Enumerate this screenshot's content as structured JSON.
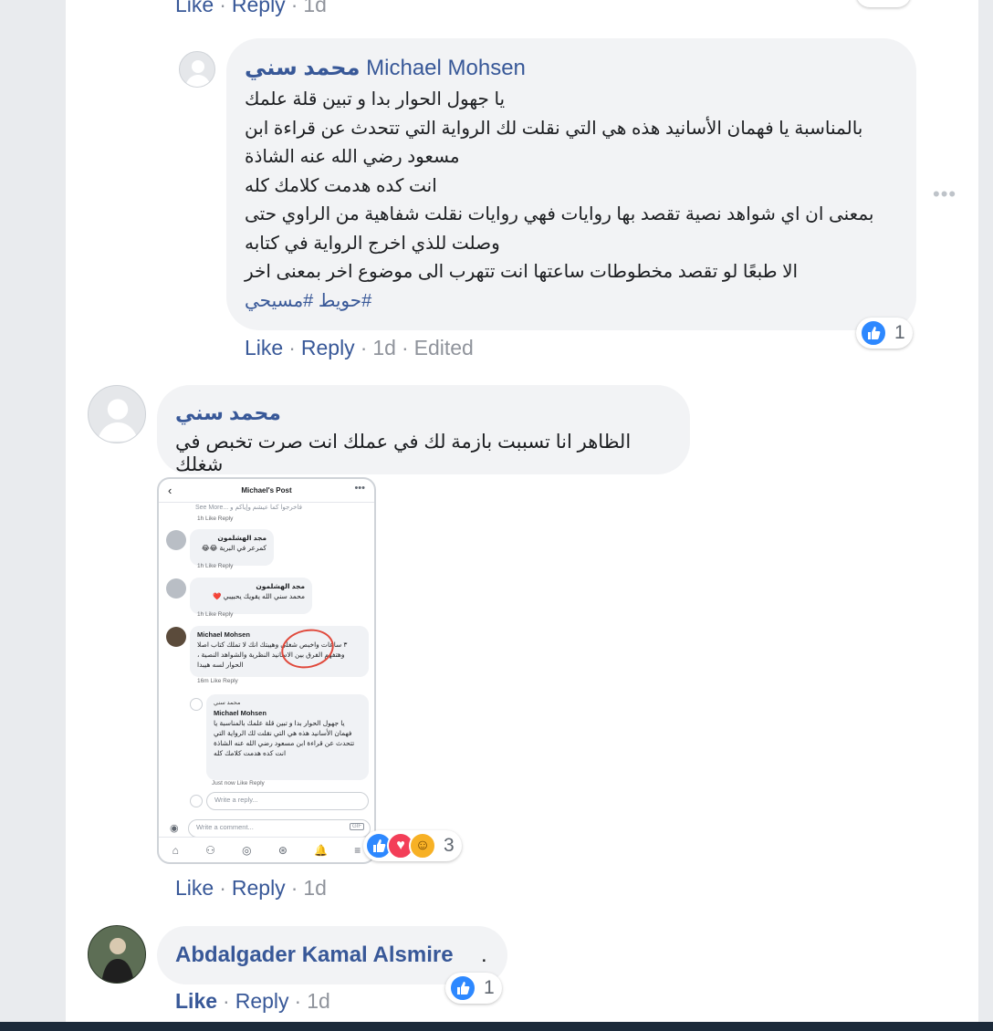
{
  "top_meta": {
    "like": "Like",
    "reply": "Reply",
    "time": "1d"
  },
  "reply_comment": {
    "author_arabic": "محمد سني",
    "author_latin": "Michael Mohsen",
    "lines": [
      "يا جهول الحوار بدا و تبين قلة علمك",
      "بالمناسبة يا فهمان الأسانيد هذه هي التي نقلت لك الرواية التي تتحدث عن قراءة ابن",
      "مسعود رضي الله عنه الشاذة",
      "انت كده هدمت كلامك كله",
      "بمعنى ان اي شواهد نصية تقصد بها روايات فهي روايات نقلت شفاهية من الراوي حتى",
      "وصلت للذي اخرج الرواية في كتابه",
      "الا طبعًا لو تقصد مخطوطات ساعتها انت تتهرب الى موضوع اخر بمعنى اخر"
    ],
    "hashtags": "#حويط #مسيحي",
    "reaction_count": "1",
    "meta": {
      "like": "Like",
      "reply": "Reply",
      "time": "1d",
      "edited": "Edited"
    }
  },
  "options_icon": "more-dots-icon",
  "comment2": {
    "author": "محمد سني",
    "text": "الظاهر انا تسببت بازمة لك في عملك انت صرت تخبص في شغلك",
    "reaction_count": "3",
    "meta": {
      "like": "Like",
      "reply": "Reply",
      "time": "1d"
    }
  },
  "phone": {
    "title": "Michael's Post",
    "top_snip": "See More... فاخرجوا كما عيشم وإياكم و",
    "top_meta": "1h   Like   Reply",
    "c1_name": "مجد الهشلمون",
    "c1_text": "كمرعر في البرية 😂😂",
    "c1_meta": "1h   Like   Reply",
    "c2_name": "مجد الهشلمون",
    "c2_text": "محمد سني الله يقويك يحبيبي ❤️",
    "c2_meta": "1h   Like   Reply",
    "c3_name": "Michael Mohsen",
    "c3_text": "٣ ساعات واخبص شغلي وهيبتك انك لا تملك كتاب اصلا وهتفهم الفرق بين الاسانيد النظرية والشواهد النصية ، الحوار لسه هيبدا",
    "c3_meta": "16m   Like   Reply",
    "r_author": "محمد سني",
    "r_name": "Michael Mohsen",
    "r_text": "يا جهول الحوار بدا و تبين قلة علمك بالمناسبة يا فهمان الأسانيد هذه هي التي نقلت لك الرواية التي تتحدث عن قراءة ابن مسعود رضي الله عنه الشاذة انت كده هدمت كلامك كله",
    "r_meta": "Just now   Like   Reply",
    "reply_placeholder": "Write a reply...",
    "comment_placeholder": "Write a comment...",
    "gif": "GIF"
  },
  "comment3": {
    "author": "Abdalgader Kamal Alsmire",
    "text": ".",
    "reaction_count": "1",
    "meta": {
      "like": "Like",
      "reply": "Reply",
      "time": "1d"
    }
  },
  "colors": {
    "link": "#385898",
    "bubble": "#f2f3f5",
    "like_blue": "#2d88ff",
    "love_red": "#f33e58",
    "haha_yellow": "#f7b125"
  }
}
